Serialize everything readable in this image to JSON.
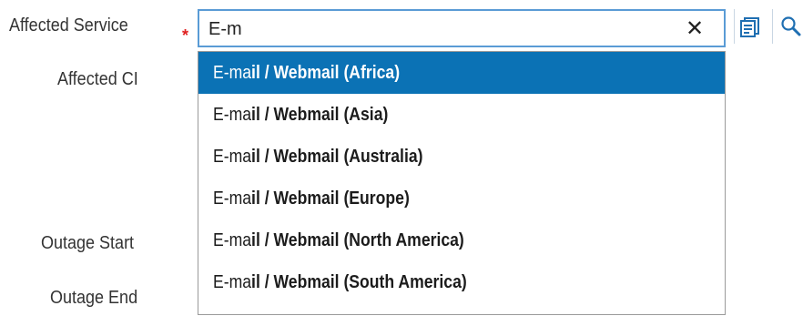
{
  "form": {
    "affected_service_label": "Affected Service",
    "required_marker": "*",
    "affected_ci_label": "Affected CI",
    "outage_start_label": "Outage Start",
    "outage_end_label": "Outage End"
  },
  "search": {
    "value": "E-m",
    "clear_icon": "close-icon",
    "lookup_icon": "list-lookup-icon",
    "search_icon": "magnifier-icon"
  },
  "dropdown": {
    "highlight_color": "#0b72b5",
    "options": [
      {
        "typed": "E-ma",
        "rest": "il / Webmail (Africa)",
        "selected": true
      },
      {
        "typed": "E-ma",
        "rest": "il / Webmail (Asia)",
        "selected": false
      },
      {
        "typed": "E-ma",
        "rest": "il / Webmail (Australia)",
        "selected": false
      },
      {
        "typed": "E-ma",
        "rest": "il / Webmail (Europe)",
        "selected": false
      },
      {
        "typed": "E-ma",
        "rest": "il / Webmail (North America)",
        "selected": false
      },
      {
        "typed": "E-ma",
        "rest": "il / Webmail (South America)",
        "selected": false
      }
    ]
  },
  "colors": {
    "required": "#e02020",
    "focus_border": "#5a9bd5",
    "icon_blue": "#1f6fb2"
  }
}
